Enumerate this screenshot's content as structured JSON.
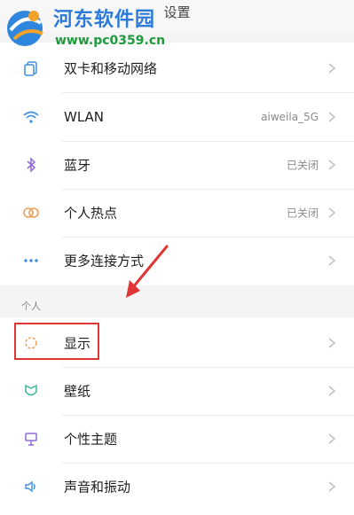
{
  "header": {
    "title": "设置"
  },
  "watermark": {
    "site_name": "河东软件园",
    "url": "www.pc0359.cn"
  },
  "network_section": {
    "items": [
      {
        "label": "双卡和移动网络",
        "value": "",
        "icon": "sim-cards-icon"
      },
      {
        "label": "WLAN",
        "value": "aiweila_5G",
        "icon": "wifi-icon"
      },
      {
        "label": "蓝牙",
        "value": "已关闭",
        "icon": "bluetooth-icon"
      },
      {
        "label": "个人热点",
        "value": "已关闭",
        "icon": "hotspot-icon"
      },
      {
        "label": "更多连接方式",
        "value": "",
        "icon": "more-dots-icon"
      }
    ]
  },
  "personal_section": {
    "header": "个人",
    "items": [
      {
        "label": "显示",
        "value": "",
        "icon": "display-icon"
      },
      {
        "label": "壁纸",
        "value": "",
        "icon": "wallpaper-icon"
      },
      {
        "label": "个性主题",
        "value": "",
        "icon": "theme-icon"
      },
      {
        "label": "声音和振动",
        "value": "",
        "icon": "sound-icon"
      }
    ]
  },
  "colors": {
    "accent_blue": "#3e8de0",
    "highlight_red": "#e03535",
    "theme_purple": "#8f6ad6",
    "hotspot_orange": "#e8a05a",
    "wallpaper_green": "#3fb59a"
  }
}
